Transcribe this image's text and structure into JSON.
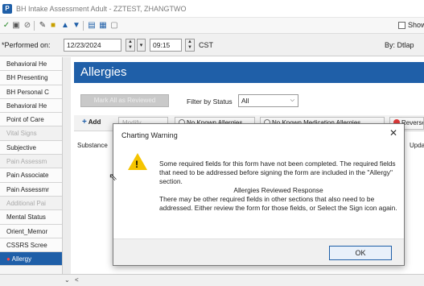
{
  "window": {
    "title": "BH Intake Assessment Adult - ZZTEST, ZHANGTWO",
    "app_icon": "P"
  },
  "toolbar": {
    "icons": [
      "checkmark-icon",
      "save-icon",
      "cancel-icon",
      "sign-icon",
      "folder-icon",
      "up-arrow-icon",
      "down-arrow-icon",
      "list-icon",
      "calendar-icon",
      "document-icon"
    ],
    "show_label": "Show"
  },
  "performed": {
    "label": "*Performed on:",
    "date": "12/23/2024",
    "time": "09:15",
    "timezone": "CST",
    "by_label": "By:  Dtlap"
  },
  "sidebar": {
    "items": [
      {
        "label": "Behavioral He",
        "state": "normal"
      },
      {
        "label": "BH Presenting",
        "state": "normal"
      },
      {
        "label": "BH Personal C",
        "state": "normal"
      },
      {
        "label": "Behavioral He",
        "state": "normal"
      },
      {
        "label": "Point of Care",
        "state": "normal"
      },
      {
        "label": "Vital Signs",
        "state": "dim"
      },
      {
        "label": "Subjective",
        "state": "normal"
      },
      {
        "label": "Pain Assessm",
        "state": "dim"
      },
      {
        "label": "Pain Associate",
        "state": "normal"
      },
      {
        "label": "Pain Assessmr",
        "state": "normal"
      },
      {
        "label": "Additional Pai",
        "state": "dim"
      },
      {
        "label": "Mental Status",
        "state": "normal"
      },
      {
        "label": "Orient_Memor",
        "state": "normal"
      },
      {
        "label": "CSSRS Scree",
        "state": "normal"
      },
      {
        "label": "Allergy",
        "state": "active"
      }
    ]
  },
  "main": {
    "title": "Allergies",
    "mark_all_label": "Mark All as Reviewed",
    "filter_label": "Filter by Status",
    "filter_value": "All",
    "actions": {
      "add": "Add",
      "modify": "Modify",
      "no_known_allergies": "No Known Allergies",
      "no_known_med_allergies": "No Known Medication Allergies",
      "reverse": "Reverse"
    },
    "columns": {
      "substance": "Substance",
      "updated": "Updated"
    }
  },
  "dialog": {
    "title": "Charting Warning",
    "close": "✕",
    "message_1": "Some required fields for this form have not been completed.  The required fields that need to be addressed before signing the form are included in the \"Allergy\" section.",
    "message_2": "Allergies Reviewed Response",
    "message_3": "There may be other required fields in other sections that also need to be addressed.  Either review the form for those fields, or Select the Sign icon again.",
    "ok_label": "OK"
  },
  "colors": {
    "accent": "#1f5fa8",
    "warning": "#f5c400"
  }
}
